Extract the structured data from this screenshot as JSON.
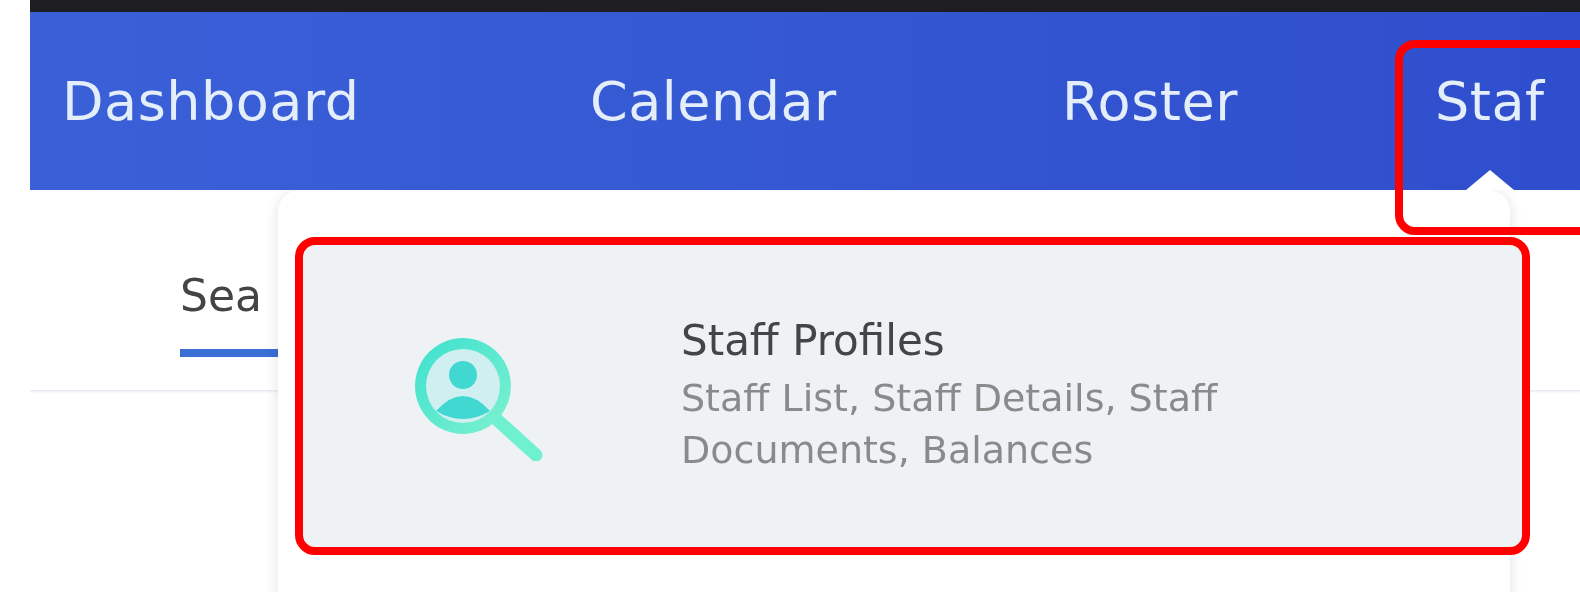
{
  "nav": {
    "items": [
      {
        "label": "Dashboard",
        "selected": false,
        "highlighted": false
      },
      {
        "label": "Calendar",
        "selected": false,
        "highlighted": false
      },
      {
        "label": "Roster",
        "selected": false,
        "highlighted": false
      },
      {
        "label": "Staf",
        "selected": true,
        "highlighted": true
      }
    ]
  },
  "tabs": [
    {
      "label": "Sea",
      "selected": true
    }
  ],
  "dropdown": {
    "items": [
      {
        "title": "Staff Profiles",
        "description": "Staff List, Staff Details, Staff Documents, Balances",
        "highlighted": true
      }
    ]
  }
}
